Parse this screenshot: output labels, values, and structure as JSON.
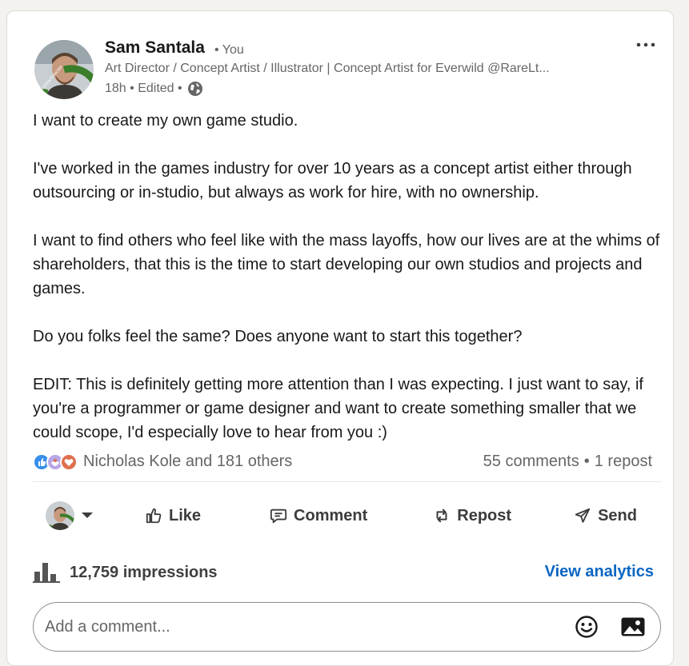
{
  "author": {
    "name": "Sam Santala",
    "relation": "• You",
    "headline": "Art Director / Concept Artist / Illustrator | Concept Artist for Everwild @RareLt...",
    "time": "18h • Edited •",
    "badge": "#OPENTOWORK",
    "visibility_icon": "globe-icon"
  },
  "post": {
    "paragraphs": [
      "I want to create my own game studio.",
      "I've worked in the games industry for over 10 years as a concept artist either through outsourcing or in-studio, but always as work for hire, with no ownership.",
      "I want to find others who feel like with the mass layoffs, how our lives are at the whims of shareholders, that this is the time to start developing our own studios and projects and games.",
      "Do you folks feel the same? Does anyone want to start this together?",
      "EDIT: This is definitely getting more attention than I was expecting. I just want to say, if you're a programmer or game designer and want to create something smaller that we could scope, I'd especially love to hear from you :)"
    ]
  },
  "social": {
    "reactions_text": "Nicholas Kole and 181 others",
    "comments": "55 comments",
    "separator": "•",
    "reposts": "1 repost",
    "reaction_icons": [
      "like-reaction-icon",
      "support-reaction-icon",
      "love-reaction-icon"
    ]
  },
  "actions": {
    "like": "Like",
    "comment": "Comment",
    "repost": "Repost",
    "send": "Send"
  },
  "analytics": {
    "impressions": "12,759 impressions",
    "view_label": "View analytics"
  },
  "comment_box": {
    "placeholder": "Add a comment..."
  },
  "colors": {
    "link": "#0a66c2",
    "opentowork": "#3a7d2a",
    "love": "#df704d",
    "like": "#378fe9"
  }
}
